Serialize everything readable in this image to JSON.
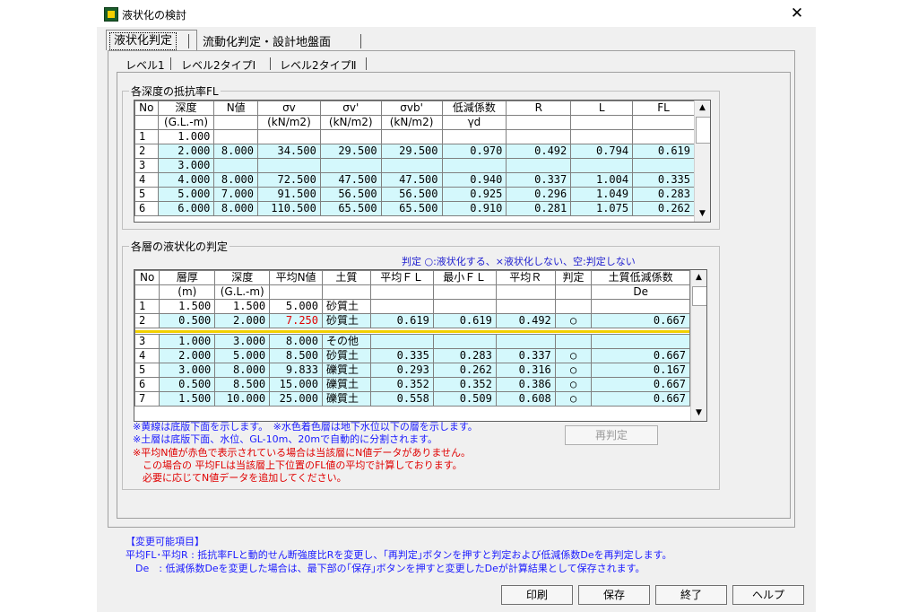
{
  "window": {
    "title": "液状化の検討",
    "close_glyph": "✕"
  },
  "tabs": {
    "active": "液状化判定",
    "other": "流動化判定・設計地盤面"
  },
  "subtabs": [
    "レベル1",
    "レベル2タイプⅠ",
    "レベル2タイプⅡ"
  ],
  "fl_group": {
    "label": "各深度の抵抗率FL",
    "headers_top": [
      "No",
      "深度",
      "N値",
      "σv",
      "σv'",
      "σvb'",
      "低減係数",
      "R",
      "L",
      "FL"
    ],
    "headers_bottom": [
      "",
      "(G.L.-m)",
      "",
      "(kN/m2)",
      "(kN/m2)",
      "(kN/m2)",
      "γd",
      "",
      "",
      ""
    ],
    "rows": [
      {
        "no": "1",
        "depth": "1.000",
        "n": "",
        "sv": "",
        "sv2": "",
        "svb": "",
        "gd": "",
        "r": "",
        "l": "",
        "fl": "",
        "cyan": false
      },
      {
        "no": "2",
        "depth": "2.000",
        "n": "8.000",
        "sv": "34.500",
        "sv2": "29.500",
        "svb": "29.500",
        "gd": "0.970",
        "r": "0.492",
        "l": "0.794",
        "fl": "0.619",
        "cyan": true
      },
      {
        "no": "3",
        "depth": "3.000",
        "n": "",
        "sv": "",
        "sv2": "",
        "svb": "",
        "gd": "",
        "r": "",
        "l": "",
        "fl": "",
        "cyan": true
      },
      {
        "no": "4",
        "depth": "4.000",
        "n": "8.000",
        "sv": "72.500",
        "sv2": "47.500",
        "svb": "47.500",
        "gd": "0.940",
        "r": "0.337",
        "l": "1.004",
        "fl": "0.335",
        "cyan": true
      },
      {
        "no": "5",
        "depth": "5.000",
        "n": "7.000",
        "sv": "91.500",
        "sv2": "56.500",
        "svb": "56.500",
        "gd": "0.925",
        "r": "0.296",
        "l": "1.049",
        "fl": "0.283",
        "cyan": true
      },
      {
        "no": "6",
        "depth": "6.000",
        "n": "8.000",
        "sv": "110.500",
        "sv2": "65.500",
        "svb": "65.500",
        "gd": "0.910",
        "r": "0.281",
        "l": "1.075",
        "fl": "0.262",
        "cyan": true
      }
    ]
  },
  "layer_group": {
    "label": "各層の液状化の判定",
    "hint": "判定 ○:液状化する、×液状化しない、空:判定しない",
    "headers_top": [
      "No",
      "層厚",
      "深度",
      "平均N値",
      "土質",
      "平均ＦＬ",
      "最小ＦＬ",
      "平均Ｒ",
      "判定",
      "土質低減係数"
    ],
    "headers_bottom": [
      "",
      "(m)",
      "(G.L.-m)",
      "",
      "",
      "",
      "",
      "",
      "",
      "De"
    ],
    "rows": [
      {
        "no": "1",
        "t": "1.500",
        "d": "1.500",
        "n": "5.000",
        "soil": "砂質土",
        "fl": "",
        "minfl": "",
        "r": "",
        "j": "",
        "de": "",
        "cyan": false,
        "red": false
      },
      {
        "no": "2",
        "t": "0.500",
        "d": "2.000",
        "n": "7.250",
        "soil": "砂質土",
        "fl": "0.619",
        "minfl": "0.619",
        "r": "0.492",
        "j": "○",
        "de": "0.667",
        "cyan": true,
        "red": true
      },
      {
        "no": "3",
        "t": "1.000",
        "d": "3.000",
        "n": "8.000",
        "soil": "その他",
        "fl": "",
        "minfl": "",
        "r": "",
        "j": "",
        "de": "",
        "cyan": true,
        "red": false
      },
      {
        "no": "4",
        "t": "2.000",
        "d": "5.000",
        "n": "8.500",
        "soil": "砂質土",
        "fl": "0.335",
        "minfl": "0.283",
        "r": "0.337",
        "j": "○",
        "de": "0.667",
        "cyan": true,
        "red": false
      },
      {
        "no": "5",
        "t": "3.000",
        "d": "8.000",
        "n": "9.833",
        "soil": "礫質土",
        "fl": "0.293",
        "minfl": "0.262",
        "r": "0.316",
        "j": "○",
        "de": "0.167",
        "cyan": true,
        "red": false
      },
      {
        "no": "6",
        "t": "0.500",
        "d": "8.500",
        "n": "15.000",
        "soil": "礫質土",
        "fl": "0.352",
        "minfl": "0.352",
        "r": "0.386",
        "j": "○",
        "de": "0.667",
        "cyan": true,
        "red": false
      },
      {
        "no": "7",
        "t": "1.500",
        "d": "10.000",
        "n": "25.000",
        "soil": "礫質土",
        "fl": "0.558",
        "minfl": "0.509",
        "r": "0.608",
        "j": "○",
        "de": "0.667",
        "cyan": true,
        "red": false
      }
    ],
    "notes_blue": [
      "※黄線は底版下面を示します。　※水色着色層は地下水位以下の層を示します。",
      "※土層は底版下面、水位、GL-10m、20mで自動的に分割されます。"
    ],
    "notes_red": [
      "※平均N値が赤色で表示されている場合は当該層にN値データがありません。",
      "　この場合の 平均FLは当該層上下位置のFL値の平均で計算しております。",
      "　必要に応じてN値データを追加してください。"
    ],
    "recalc_button": "再判定"
  },
  "info": {
    "heading": "【変更可能項目】",
    "line1": "平均FL･平均R : 抵抗率FLと動的せん断強度比Rを変更し、｢再判定｣ボタンを押すと判定および低減係数Deを再判定します。",
    "line2": "　De　: 低減係数Deを変更した場合は、最下部の｢保存｣ボタンを押すと変更したDeが計算結果として保存されます。"
  },
  "buttons": {
    "print": "印刷",
    "save": "保存",
    "end": "終了",
    "help": "ヘルプ"
  },
  "colors": {
    "cyan_row": "#d4f8fc",
    "yellow_line": "#f2d000",
    "red_value": "#e00000",
    "note_blue": "#1a1aff",
    "note_red": "#e00000"
  }
}
